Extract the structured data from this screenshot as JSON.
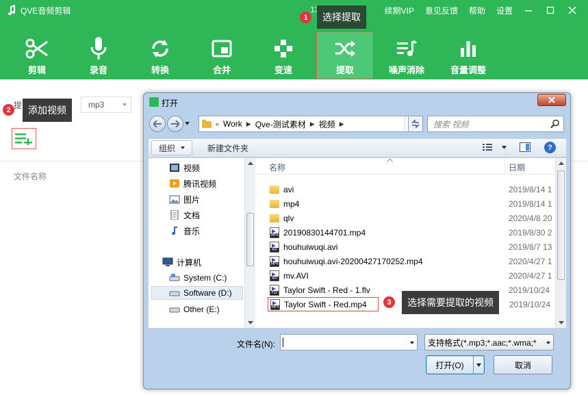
{
  "app": {
    "title": "QVE音频剪辑",
    "phone": "13492566608",
    "top_links": [
      "续期VIP",
      "意见反馈",
      "帮助",
      "设置"
    ]
  },
  "toolbar": {
    "tools": [
      {
        "label": "剪辑",
        "icon": "scissors-icon"
      },
      {
        "label": "录音",
        "icon": "microphone-icon"
      },
      {
        "label": "转换",
        "icon": "convert-icon"
      },
      {
        "label": "合并",
        "icon": "merge-icon"
      },
      {
        "label": "变速",
        "icon": "speed-icon"
      },
      {
        "label": "提取",
        "icon": "shuffle-icon",
        "active": true
      },
      {
        "label": "噪声消除",
        "icon": "noise-icon"
      },
      {
        "label": "音量调整",
        "icon": "volume-bars-icon"
      }
    ]
  },
  "annotations": {
    "step1": {
      "num": "1",
      "text": "选择提取"
    },
    "step2": {
      "num": "2",
      "text": "添加视频"
    },
    "step3": {
      "num": "3",
      "text": "选择需要提取的视频"
    }
  },
  "panel": {
    "format_label": "提取音频格式",
    "format_value": "mp3",
    "file_name_header": "文件名称"
  },
  "dialog": {
    "title": "打开",
    "breadcrumb": [
      "Work",
      "Qve-测试素材",
      "视频"
    ],
    "search_placeholder": "搜索 视频",
    "organize": "组织",
    "new_folder": "新建文件夹",
    "nav_items": [
      {
        "label": "视频",
        "icon": "video-library-icon",
        "section": "libraries"
      },
      {
        "label": "腾讯视频",
        "icon": "tencent-video-icon",
        "section": "libraries"
      },
      {
        "label": "图片",
        "icon": "pictures-icon",
        "section": "libraries"
      },
      {
        "label": "文档",
        "icon": "documents-icon",
        "section": "libraries"
      },
      {
        "label": "音乐",
        "icon": "music-icon",
        "section": "libraries"
      },
      {
        "label": "计算机",
        "icon": "computer-icon",
        "section": "computer"
      },
      {
        "label": "System (C:)",
        "icon": "drive-icon",
        "section": "computer"
      },
      {
        "label": "Software (D:)",
        "icon": "drive-icon",
        "section": "computer",
        "selected": true
      },
      {
        "label": "Other (E:)",
        "icon": "drive-icon",
        "section": "computer"
      }
    ],
    "columns": {
      "name": "名称",
      "date": "日期"
    },
    "files": [
      {
        "name": "avi",
        "date": "2019/8/14 1",
        "type": "folder"
      },
      {
        "name": "mp4",
        "date": "2019/8/14 1",
        "type": "folder"
      },
      {
        "name": "qlv",
        "date": "2020/4/8 20",
        "type": "folder"
      },
      {
        "name": "20190830144701.mp4",
        "date": "2019/8/30 2",
        "type": "MP4"
      },
      {
        "name": "houhuiwuqi.avi",
        "date": "2019/8/7 13",
        "type": "AVI"
      },
      {
        "name": "houhuiwuqi.avi-20200427170252.mp4",
        "date": "2020/4/27 1",
        "type": "MP4"
      },
      {
        "name": "mv.AVI",
        "date": "2020/4/27 1",
        "type": "AVI"
      },
      {
        "name": "Taylor Swift - Red - 1.flv",
        "date": "2019/10/24",
        "type": "FLV"
      },
      {
        "name": "Taylor Swift - Red.mp4",
        "date": "2019/10/24",
        "type": "MP4",
        "highlighted": true
      }
    ],
    "filename_label": "文件名(N):",
    "filename_value": "",
    "file_type": "支持格式(*.mp3;*.aac;*.wma;*",
    "open_button": "打开(O)",
    "cancel_button": "取消"
  },
  "colors": {
    "brand_green": "#2fb757",
    "highlight_red": "#e04b3e",
    "badge_red": "#e4343b"
  }
}
